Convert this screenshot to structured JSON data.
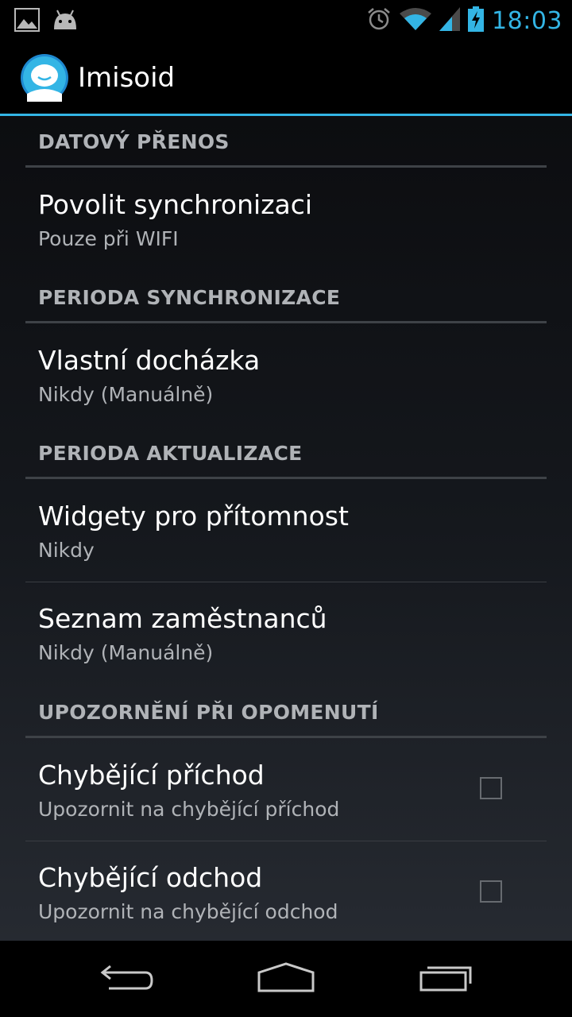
{
  "status_bar": {
    "time": "18:03",
    "left_icons": [
      "gallery-icon",
      "android-icon"
    ],
    "right_icons": [
      "alarm-icon",
      "wifi-icon",
      "signal-icon",
      "battery-charging-icon"
    ],
    "time_color": "#33b5e5"
  },
  "action_bar": {
    "title": "Imisoid",
    "app_icon": "imisoid-app-icon",
    "accent_color": "#33b5e5"
  },
  "sections": [
    {
      "header": "DATOVÝ PŘENOS",
      "items": [
        {
          "title": "Povolit synchronizaci",
          "summary": "Pouze při WIFI"
        }
      ]
    },
    {
      "header": "PERIODA SYNCHRONIZACE",
      "items": [
        {
          "title": "Vlastní docházka",
          "summary": "Nikdy (Manuálně)"
        }
      ]
    },
    {
      "header": "PERIODA AKTUALIZACE",
      "items": [
        {
          "title": "Widgety pro přítomnost",
          "summary": "Nikdy"
        },
        {
          "title": "Seznam zaměstnanců",
          "summary": "Nikdy (Manuálně)"
        }
      ]
    },
    {
      "header": "UPOZORNĚNÍ PŘI OPOMENUTÍ",
      "items": [
        {
          "title": "Chybějící příchod",
          "summary": "Upozornit na chybějící příchod",
          "checked": false
        },
        {
          "title": "Chybějící odchod",
          "summary": "Upozornit na chybějící odchod",
          "checked": false
        }
      ]
    }
  ],
  "nav_bar": {
    "buttons": [
      "back-icon",
      "home-icon",
      "recents-icon"
    ]
  }
}
